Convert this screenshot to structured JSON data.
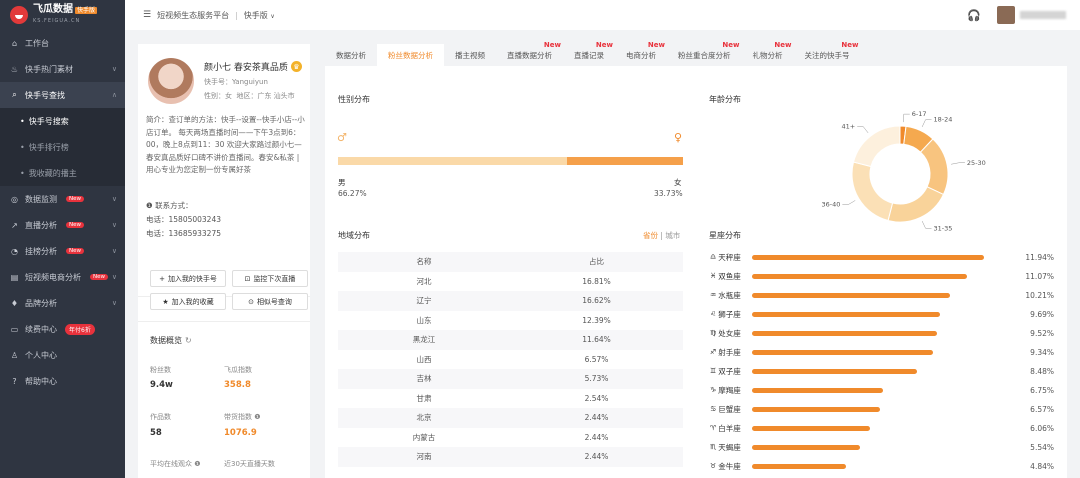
{
  "logo": {
    "title": "飞瓜数据",
    "tag": "快手版",
    "sub": "KS.FEIGUA.CN"
  },
  "sidebar": {
    "items": [
      {
        "label": "工作台",
        "icon": "home-icon"
      },
      {
        "label": "快手热门素材",
        "icon": "fire-icon"
      },
      {
        "label": "快手号查找",
        "icon": "search-icon",
        "active": true
      },
      {
        "label": "快手号搜索",
        "sub": true,
        "active": true
      },
      {
        "label": "快手排行榜",
        "sub": true
      },
      {
        "label": "我收藏的播主",
        "sub": true
      },
      {
        "label": "数据监测",
        "icon": "monitor-icon",
        "badge": "New"
      },
      {
        "label": "直播分析",
        "icon": "chart-icon",
        "badge": "New"
      },
      {
        "label": "挂榜分析",
        "icon": "pie-icon",
        "badge": "New"
      },
      {
        "label": "短视频电商分析",
        "icon": "shop-icon",
        "badge": "New"
      },
      {
        "label": "品牌分析",
        "icon": "diamond-icon"
      },
      {
        "label": "续费中心",
        "icon": "card-icon",
        "badge": "年付6折"
      },
      {
        "label": "个人中心",
        "icon": "user-icon"
      },
      {
        "label": "帮助中心",
        "icon": "help-icon"
      }
    ]
  },
  "topbar": {
    "title": "短视频生态服务平台",
    "separator": "|",
    "version": "快手版"
  },
  "profile": {
    "name": "颜小七 春安茶真品质",
    "id_label": "快手号：",
    "id": "Yanguiyun",
    "gender_label": "性别：",
    "gender": "女",
    "region_label": "地区：",
    "region": "广东 汕头市",
    "intro": "简介：查订单的方法：快手--设置--快手小店--小店订单。 每天两场直播时间——下午3点到6：00，晚上8点到11：30 欢迎大家路过颜小七—春安真品质好口碑不讲价直播间。春安&私茶 | 用心专业为您定制一份专属好茶",
    "contact_title": "联系方式：",
    "phones": [
      "电话：15805003243",
      "电话：13685933275"
    ],
    "buttons": {
      "add": "加入我的快手号",
      "monitor": "监控下次直播",
      "collect": "加入我的收藏",
      "similar": "相似号查询"
    },
    "overview_title": "数据概览",
    "stats": {
      "fans_label": "粉丝数",
      "fans": "9.4w",
      "index_label": "飞瓜指数",
      "index": "358.8",
      "works_label": "作品数",
      "works": "58",
      "goods_label": "带货指数",
      "goods": "1076.9",
      "avg_label": "平均在线观众",
      "live_label": "近30天直播天数"
    }
  },
  "tabs": [
    {
      "label": "数据分析"
    },
    {
      "label": "粉丝数据分析",
      "active": true
    },
    {
      "label": "播主视频"
    },
    {
      "label": "直播数据分析",
      "new": "New"
    },
    {
      "label": "直播记录",
      "new": "New"
    },
    {
      "label": "电商分析",
      "new": "New"
    },
    {
      "label": "粉丝重合度分析",
      "new": "New"
    },
    {
      "label": "礼物分析",
      "new": "New"
    },
    {
      "label": "关注的快手号",
      "new": "New"
    }
  ],
  "gender": {
    "title": "性别分布",
    "male_label": "男",
    "male_pct": "66.27%",
    "male": 66.27,
    "female_label": "女",
    "female_pct": "33.73%",
    "female": 33.73,
    "male_color": "#fad9a8",
    "female_color": "#f5a04a"
  },
  "region": {
    "title": "地域分布",
    "toggle_province": "省份",
    "toggle_city": "城市",
    "toggle_sep": "|",
    "col_name": "名称",
    "col_pct": "占比",
    "rows": [
      {
        "name": "河北",
        "pct": "16.81%"
      },
      {
        "name": "辽宁",
        "pct": "16.62%"
      },
      {
        "name": "山东",
        "pct": "12.39%"
      },
      {
        "name": "黑龙江",
        "pct": "11.64%"
      },
      {
        "name": "山西",
        "pct": "6.57%"
      },
      {
        "name": "吉林",
        "pct": "5.73%"
      },
      {
        "name": "甘肃",
        "pct": "2.54%"
      },
      {
        "name": "北京",
        "pct": "2.44%"
      },
      {
        "name": "内蒙古",
        "pct": "2.44%"
      },
      {
        "name": "河南",
        "pct": "2.44%"
      }
    ]
  },
  "age": {
    "title": "年龄分布",
    "segments": [
      {
        "label": "6-17",
        "value": 2,
        "color": "#f08a2b"
      },
      {
        "label": "18-24",
        "value": 10,
        "color": "#f5a94f"
      },
      {
        "label": "25-30",
        "value": 20,
        "color": "#f8c47f"
      },
      {
        "label": "31-35",
        "value": 22,
        "color": "#f9d39a"
      },
      {
        "label": "36-40",
        "value": 25,
        "color": "#fbe0b6"
      },
      {
        "label": "41+",
        "value": 21,
        "color": "#fdf0dd"
      }
    ]
  },
  "zodiac": {
    "title": "星座分布",
    "rows": [
      {
        "name": "天秤座",
        "icon": "libra-icon",
        "glyph": "♎",
        "pct": "11.94%",
        "value": 11.94
      },
      {
        "name": "双鱼座",
        "icon": "pisces-icon",
        "glyph": "♓",
        "pct": "11.07%",
        "value": 11.07
      },
      {
        "name": "水瓶座",
        "icon": "aquarius-icon",
        "glyph": "♒",
        "pct": "10.21%",
        "value": 10.21
      },
      {
        "name": "狮子座",
        "icon": "leo-icon",
        "glyph": "♌",
        "pct": "9.69%",
        "value": 9.69
      },
      {
        "name": "处女座",
        "icon": "virgo-icon",
        "glyph": "♍",
        "pct": "9.52%",
        "value": 9.52
      },
      {
        "name": "射手座",
        "icon": "sagittarius-icon",
        "glyph": "♐",
        "pct": "9.34%",
        "value": 9.34
      },
      {
        "name": "双子座",
        "icon": "gemini-icon",
        "glyph": "♊",
        "pct": "8.48%",
        "value": 8.48
      },
      {
        "name": "摩羯座",
        "icon": "capricorn-icon",
        "glyph": "♑",
        "pct": "6.75%",
        "value": 6.75
      },
      {
        "name": "巨蟹座",
        "icon": "cancer-icon",
        "glyph": "♋",
        "pct": "6.57%",
        "value": 6.57
      },
      {
        "name": "白羊座",
        "icon": "aries-icon",
        "glyph": "♈",
        "pct": "6.06%",
        "value": 6.06
      },
      {
        "name": "天蝎座",
        "icon": "scorpio-icon",
        "glyph": "♏",
        "pct": "5.54%",
        "value": 5.54
      },
      {
        "name": "金牛座",
        "icon": "taurus-icon",
        "glyph": "♉",
        "pct": "4.84%",
        "value": 4.84
      }
    ],
    "max": 14
  },
  "colors": {
    "accent": "#f08a2b",
    "sidebar_bg": "#2f3541",
    "new_badge": "#e8323c"
  }
}
